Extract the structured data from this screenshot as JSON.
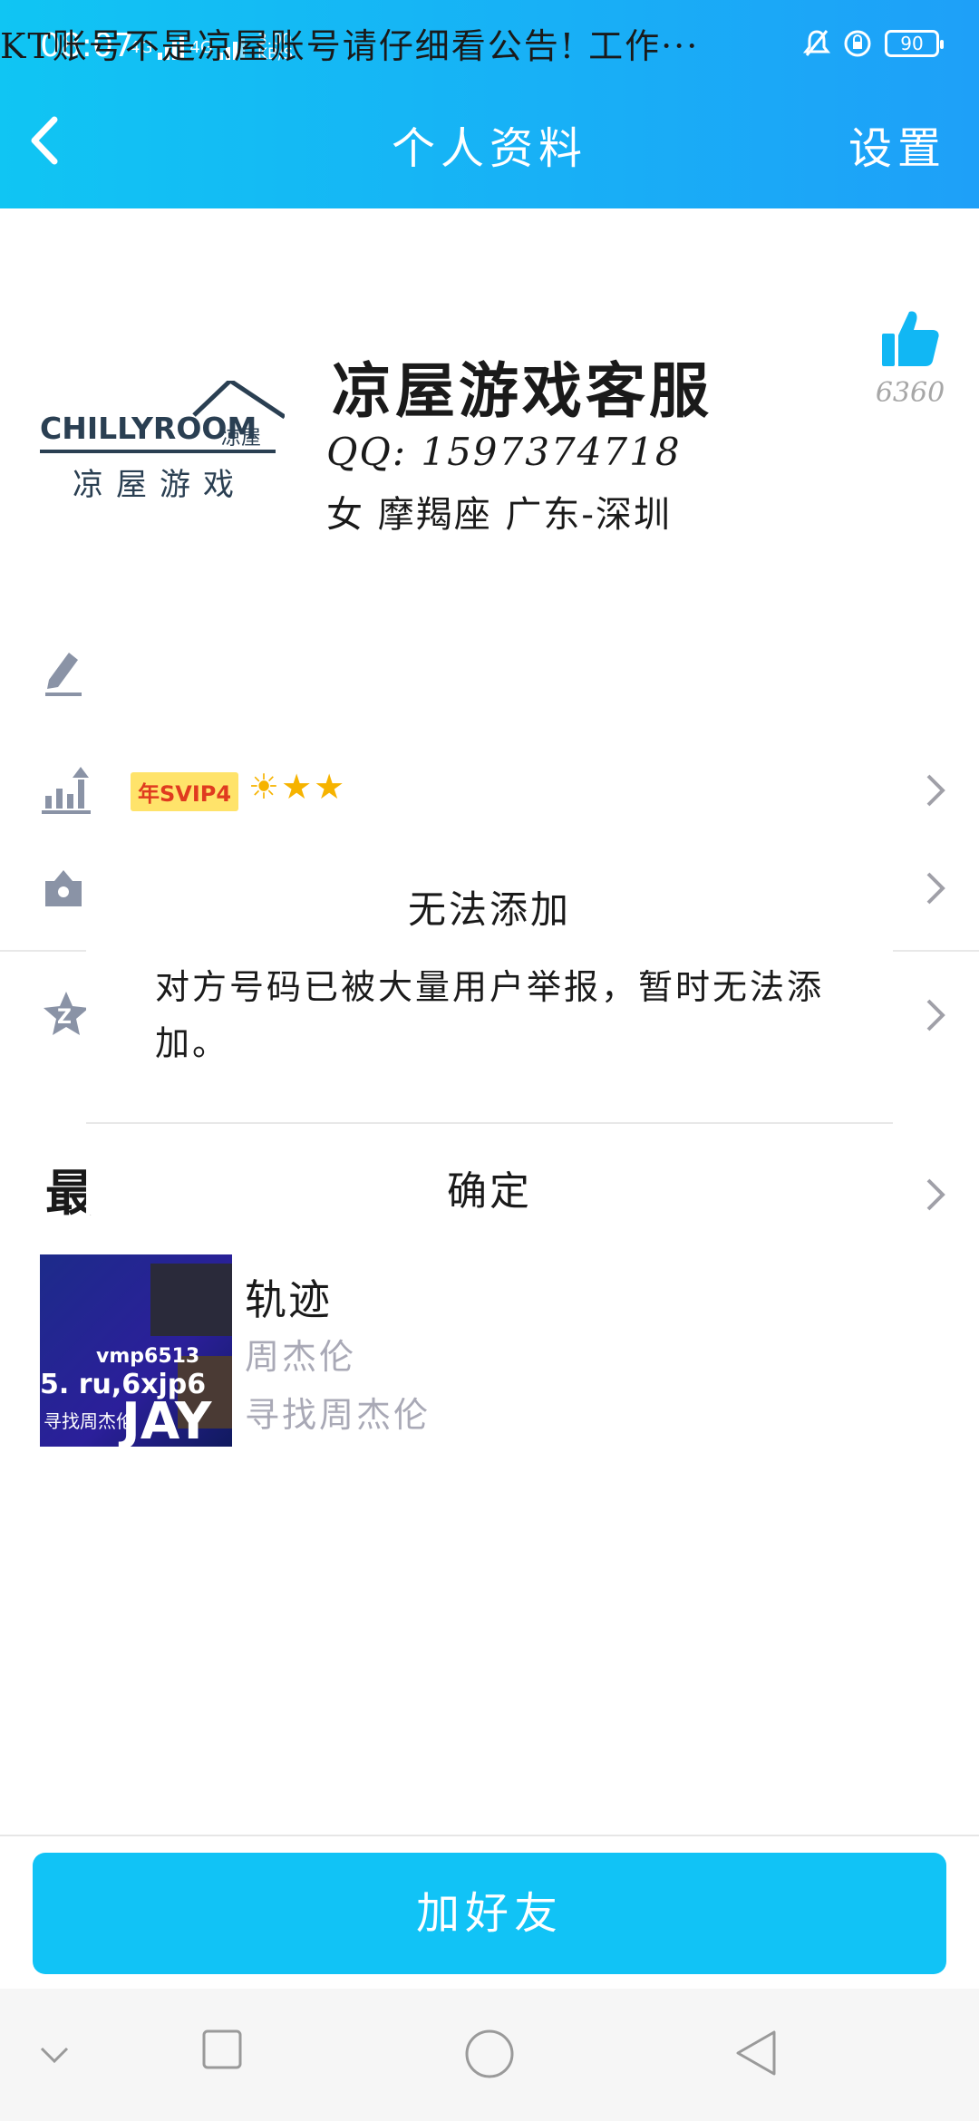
{
  "status_bar": {
    "time": "08:07",
    "network1": "4G",
    "network2": "4G",
    "speed_value": "3.00",
    "speed_unit": "KB/S",
    "battery": "90"
  },
  "nav": {
    "title": "个人资料",
    "settings_label": "设置"
  },
  "profile": {
    "logo_text": "CHILLYROOM",
    "logo_subtitle": "凉屋游戏",
    "logo_mark": "凉屋",
    "name": "凉屋游戏客服",
    "qq": "QQ: 1597374718",
    "info": "女  摩羯座  广东-深圳",
    "like_count": "6360"
  },
  "signature": {
    "text": "KT账号不是凉屋账号请仔细看公告! 工作···"
  },
  "vip": {
    "badge": "年SVIP4",
    "stars": "☀★★"
  },
  "dialog": {
    "title": "无法添加",
    "message": "对方号码已被大量用户举报，暂时无法添加。",
    "confirm_label": "确定"
  },
  "recent_label": "最",
  "music": {
    "song": "轨迹",
    "artist": "周杰伦",
    "album": "寻找周杰伦",
    "cover_text1": "vmp6513",
    "cover_text2": "5. ru,6xjp6",
    "cover_text3": "寻找周杰伦",
    "cover_text4": "JAY"
  },
  "bottom": {
    "add_friend_label": "加好友"
  },
  "colors": {
    "header_start": "#10c5f3",
    "header_end": "#1ea0f8",
    "accent": "#11c3f6"
  }
}
